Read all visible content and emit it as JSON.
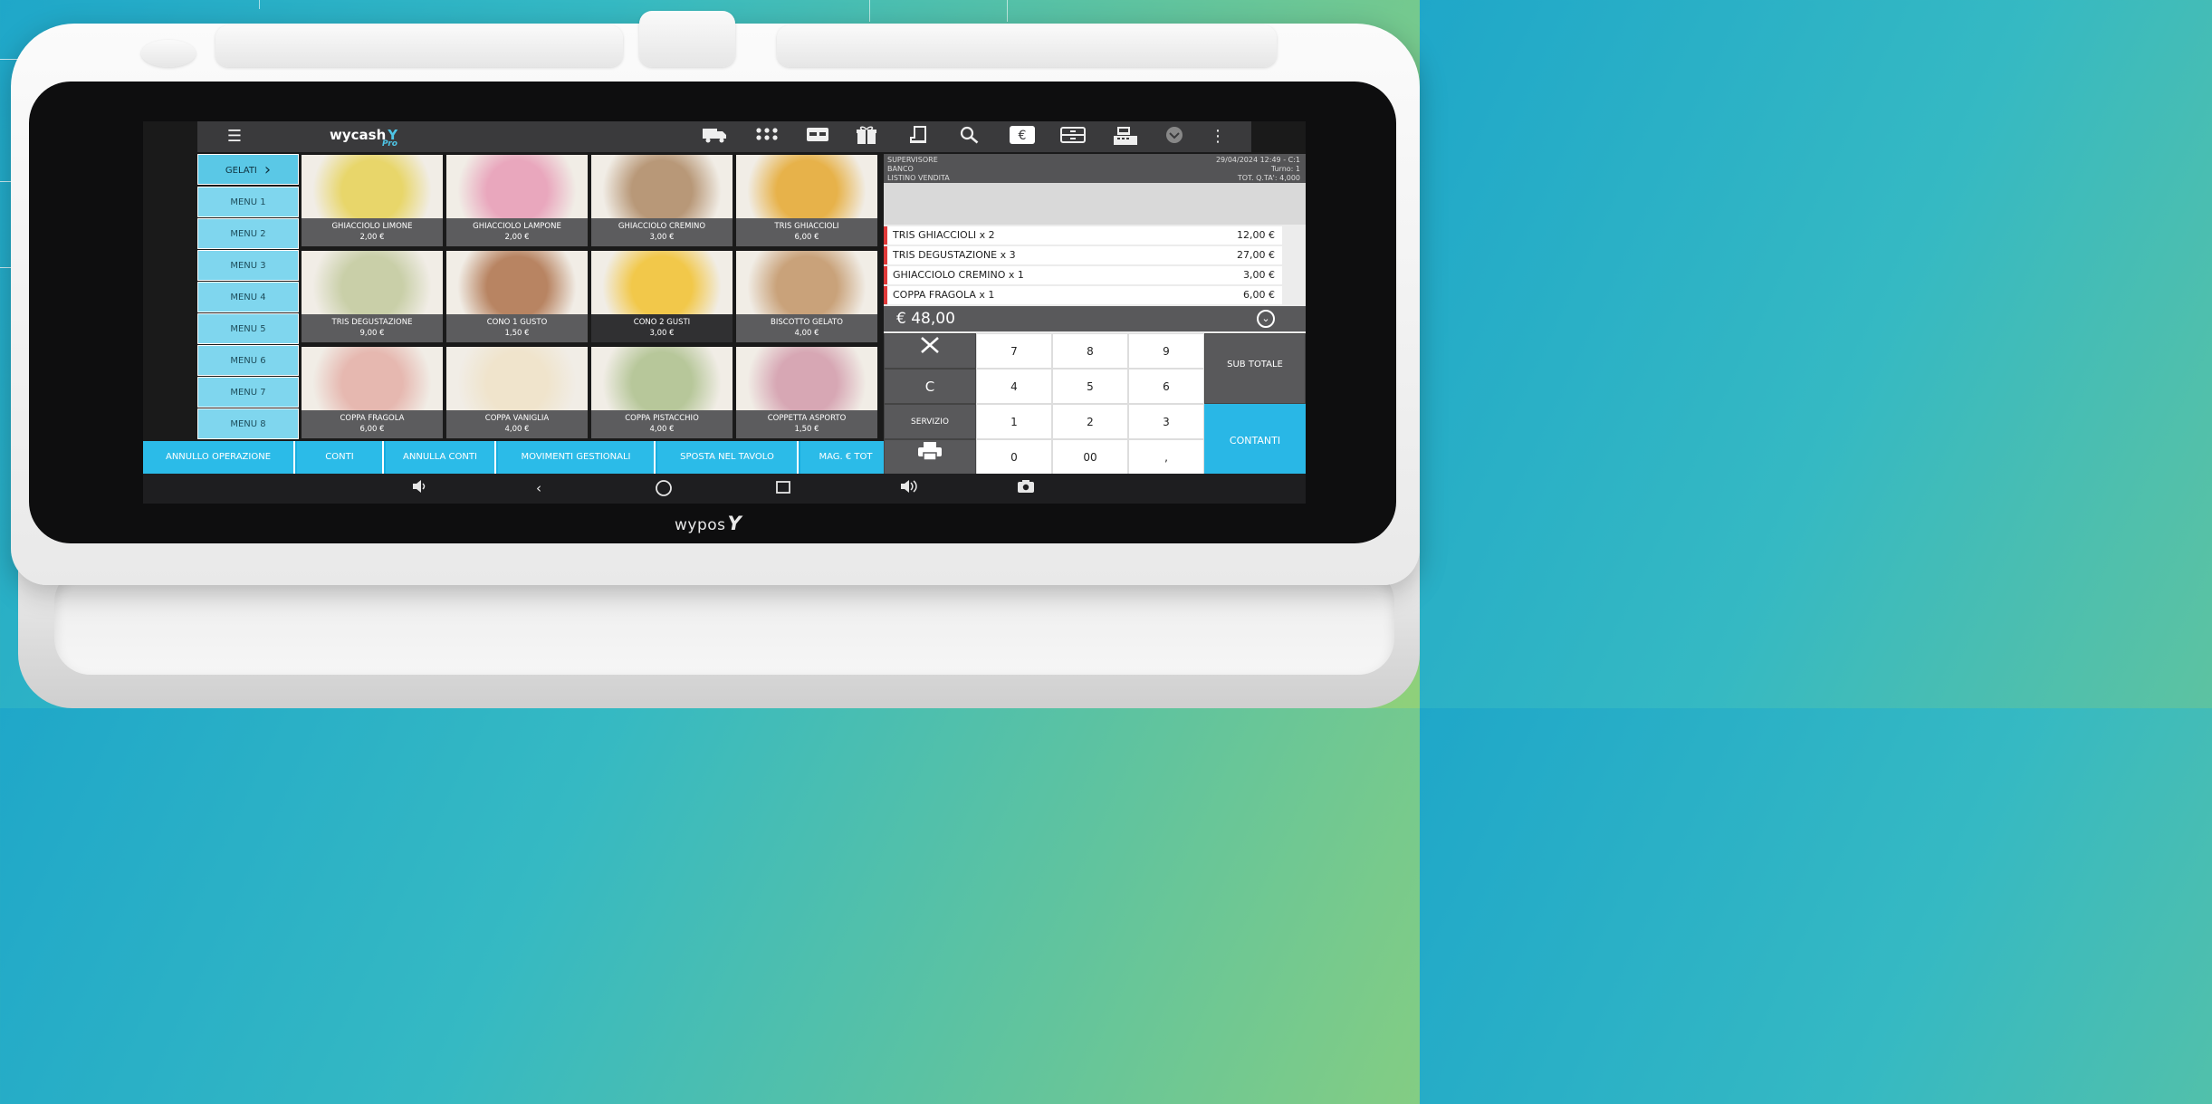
{
  "app": {
    "logo": "wycash",
    "logo_sub": "Pro"
  },
  "device": {
    "brand": "wypos"
  },
  "topbar": {
    "icons": [
      "menu-icon",
      "delivery-truck-icon",
      "apps-grid-icon",
      "card-icon",
      "gift-icon",
      "receipt-printer-icon",
      "search-icon",
      "euro-icon",
      "cash-drawer-icon",
      "cash-register-icon",
      "dropdown-circle-icon",
      "more-vert-icon"
    ]
  },
  "categories": {
    "active": "GELATI",
    "items": [
      "MENU 1",
      "MENU 2",
      "MENU 3",
      "MENU 4",
      "MENU 5",
      "MENU 6",
      "MENU 7",
      "MENU 8"
    ]
  },
  "products": [
    {
      "name": "GHIACCIOLO LIMONE",
      "price": "2,00 €",
      "color": "#e8d66a"
    },
    {
      "name": "GHIACCIOLO LAMPONE",
      "price": "2,00 €",
      "color": "#e9a7bd"
    },
    {
      "name": "GHIACCIOLO CREMINO",
      "price": "3,00 €",
      "color": "#b89878"
    },
    {
      "name": "TRIS GHIACCIOLI",
      "price": "6,00 €",
      "color": "#e7b24a"
    },
    {
      "name": "TRIS DEGUSTAZIONE",
      "price": "9,00 €",
      "color": "#c9cfa8"
    },
    {
      "name": "CONO 1 GUSTO",
      "price": "1,50 €",
      "color": "#b88462"
    },
    {
      "name": "CONO 2 GUSTI",
      "price": "3,00 €",
      "color": "#f2c84a"
    },
    {
      "name": "BISCOTTO GELATO",
      "price": "4,00 €",
      "color": "#c9a27a"
    },
    {
      "name": "COPPA FRAGOLA",
      "price": "6,00 €",
      "color": "#e6b8b0"
    },
    {
      "name": "COPPA VANIGLIA",
      "price": "4,00 €",
      "color": "#f0e4cc"
    },
    {
      "name": "COPPA PISTACCHIO",
      "price": "4,00 €",
      "color": "#b7c79a"
    },
    {
      "name": "COPPETTA ASPORTO",
      "price": "1,50 €",
      "color": "#d7a7b4"
    }
  ],
  "actions": [
    "ANNULLO OPERAZIONE",
    "CONTI",
    "ANNULLA CONTI",
    "MOVIMENTI GESTIONALI",
    "SPOSTA NEL TAVOLO",
    "MAG. € TOT"
  ],
  "info": {
    "operator": "SUPERVISORE",
    "location": "BANCO",
    "price_list": "LISTINO VENDITA",
    "datetime": "29/04/2024 12:49 - C:1",
    "shift": "Turno: 1",
    "qty_total": "TOT. Q.TA': 4,000"
  },
  "order_lines": [
    {
      "label": "TRIS GHIACCIOLI x 2",
      "amount": "12,00 €"
    },
    {
      "label": "TRIS DEGUSTAZIONE x 3",
      "amount": "27,00 €"
    },
    {
      "label": "GHIACCIOLO CREMINO x 1",
      "amount": "3,00 €"
    },
    {
      "label": "COPPA FRAGOLA x 1",
      "amount": "6,00 €"
    }
  ],
  "total": "€ 48,00",
  "keypad": {
    "clear": "C",
    "service": "SERVIZIO",
    "digits": [
      "7",
      "8",
      "9",
      "4",
      "5",
      "6",
      "1",
      "2",
      "3",
      "0",
      "00",
      ","
    ],
    "subtotal": "SUB TOTALE",
    "cash": "CONTANTI"
  },
  "navbar": [
    "volume-down-icon",
    "back-icon",
    "home-icon",
    "recents-icon",
    "volume-up-icon",
    "screenshot-icon"
  ]
}
